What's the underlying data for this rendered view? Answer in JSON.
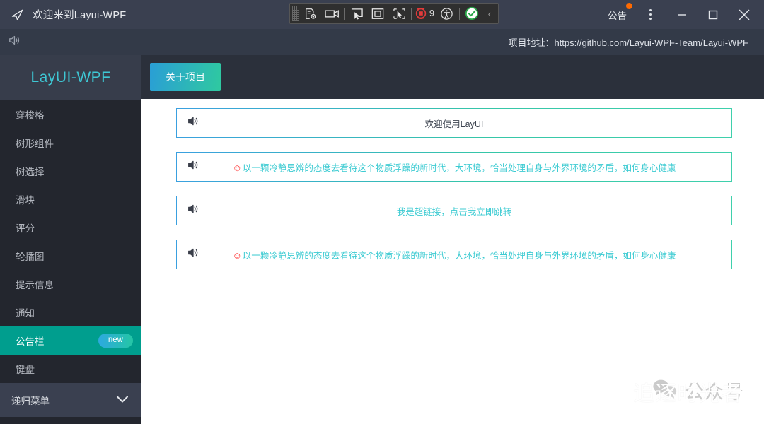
{
  "titlebar": {
    "logo_icon": "paper-plane-icon",
    "title": "欢迎来到Layui-WPF",
    "notice_label": "公告",
    "notice_badge_dot": true,
    "kebab_icon": "more-vertical-icon",
    "minimize_icon": "minimize-icon",
    "maximize_icon": "maximize-icon",
    "close_icon": "close-icon",
    "bg_color": "#3a4050"
  },
  "capture_toolbar": {
    "grip_icon": "drag-grip-icon",
    "buttons": [
      {
        "icon": "screenshot-settings-icon",
        "label": ""
      },
      {
        "icon": "record-video-icon",
        "label": ""
      },
      {
        "icon": "cursor-select-icon",
        "label": ""
      },
      {
        "icon": "region-select-icon",
        "label": ""
      },
      {
        "icon": "window-select-icon",
        "label": ""
      }
    ],
    "stop_icon": "stop-record-icon",
    "count": "9",
    "accessibility_icon": "accessibility-icon",
    "status_icon": "check-circle-icon",
    "collapse_icon": "chevron-left-icon",
    "bg_color": "#2f2f2f"
  },
  "subbar": {
    "volume_icon": "speaker-icon",
    "project_label": "项目地址：",
    "project_url": "https://github.com/Layui-WPF-Team/Layui-WPF",
    "bg_color": "#333a48"
  },
  "sidebar": {
    "brand": "LayUI-WPF",
    "brand_color": "#3ec7d4",
    "bg_color": "#23262e",
    "active_color": "#009e8e",
    "items": [
      {
        "label": "穿梭格",
        "active": false,
        "badge": null
      },
      {
        "label": "树形组件",
        "active": false,
        "badge": null
      },
      {
        "label": "树选择",
        "active": false,
        "badge": null
      },
      {
        "label": "滑块",
        "active": false,
        "badge": null
      },
      {
        "label": "评分",
        "active": false,
        "badge": null
      },
      {
        "label": "轮播图",
        "active": false,
        "badge": null
      },
      {
        "label": "提示信息",
        "active": false,
        "badge": null
      },
      {
        "label": "通知",
        "active": false,
        "badge": null
      },
      {
        "label": "公告栏",
        "active": true,
        "badge": "new"
      },
      {
        "label": "键盘",
        "active": false,
        "badge": null
      }
    ],
    "group": {
      "label": "递归菜单",
      "chevron_icon": "chevron-down-icon"
    }
  },
  "main": {
    "tabs": [
      {
        "label": "关于项目",
        "active": true
      }
    ],
    "cards": [
      {
        "speaker_icon": "speaker-icon",
        "emoji": "",
        "text": "欢迎使用LayUI",
        "style": "dark"
      },
      {
        "speaker_icon": "speaker-icon",
        "emoji": "☺",
        "text": "以一颗冷静思辨的态度去看待这个物质浮躁的新时代，大环境，恰当处理自身与外界环境的矛盾，如何身心健康",
        "style": "teal"
      },
      {
        "speaker_icon": "speaker-icon",
        "emoji": "",
        "text": "我是超链接，点击我立即跳转",
        "style": "link"
      },
      {
        "speaker_icon": "speaker-icon",
        "emoji": "☺",
        "text": "以一颗冷静思辨的态度去看待这个物质浮躁的新时代，大环境，恰当处理自身与外界环境的矛盾，如何身心健康",
        "style": "teal"
      }
    ]
  },
  "watermark": {
    "wechat_icon": "wechat-icon",
    "label": "公众号",
    "overlay_text": "追逐时光者"
  }
}
